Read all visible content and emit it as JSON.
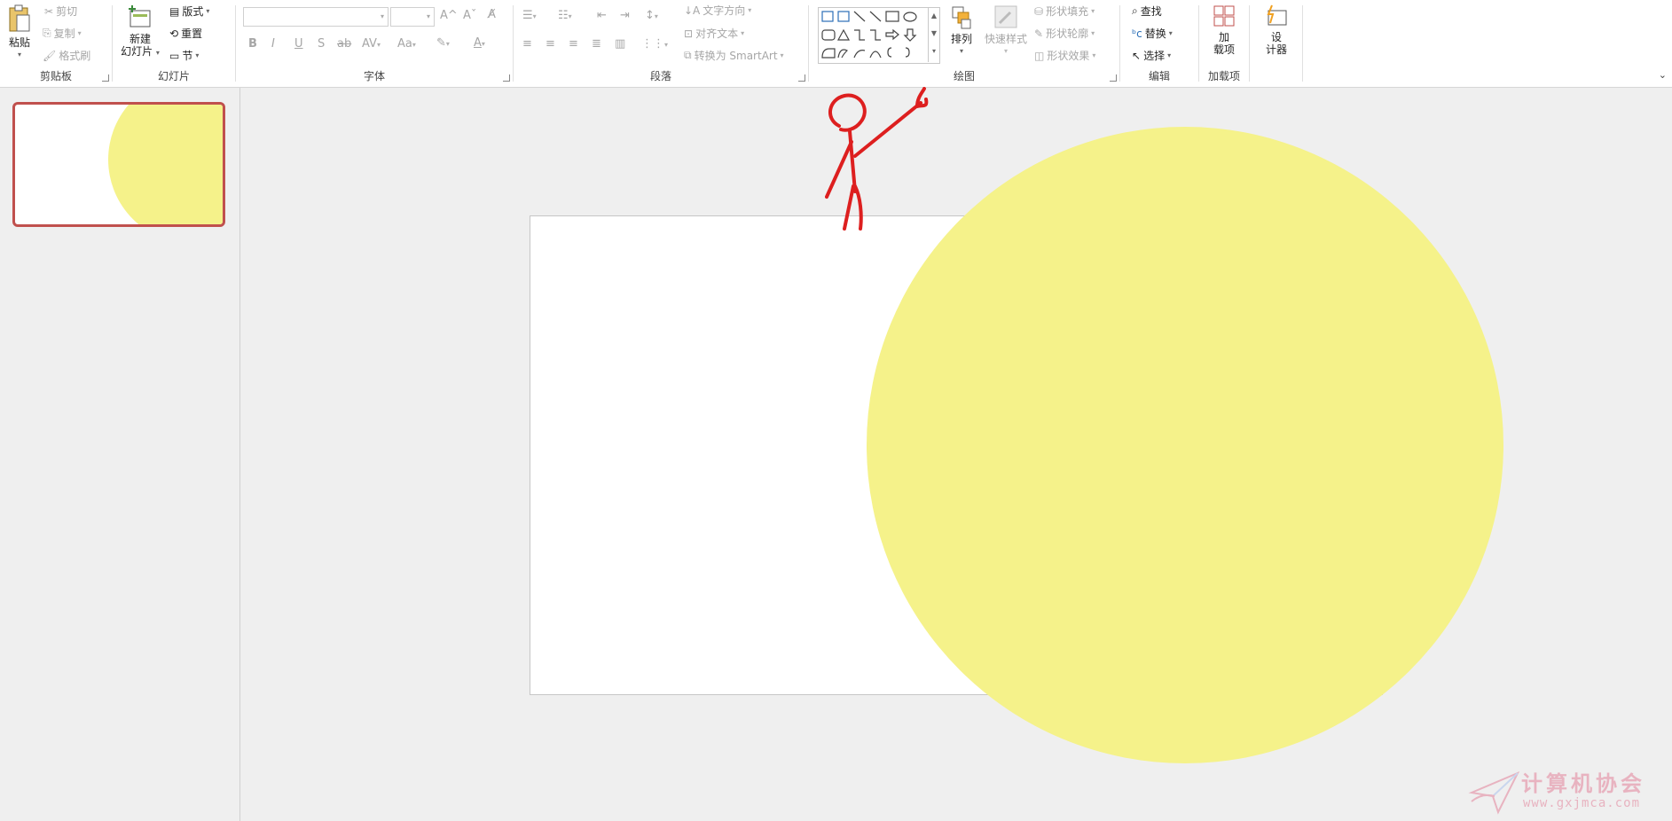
{
  "ribbon": {
    "clipboard": {
      "paste": "粘贴",
      "cut": "剪切",
      "copy": "复制",
      "format_painter": "格式刷",
      "label": "剪贴板"
    },
    "slides": {
      "new_slide_line1": "新建",
      "new_slide_line2": "幻灯片",
      "layout": "版式",
      "reset": "重置",
      "section": "节",
      "label": "幻灯片"
    },
    "font": {
      "label": "字体",
      "bold": "B",
      "italic": "I",
      "underline": "U",
      "shadow": "S",
      "strike": "ab",
      "spacing": "AV",
      "case": "Aa",
      "grow": "A^",
      "shrink": "Aˇ",
      "color": "A"
    },
    "paragraph": {
      "label": "段落",
      "text_direction": "文字方向",
      "align_text": "对齐文本",
      "smartart": "转换为 SmartArt"
    },
    "drawing": {
      "label": "绘图",
      "arrange": "排列",
      "quick_styles": "快速样式",
      "shape_fill": "形状填充",
      "shape_outline": "形状轮廓",
      "shape_effects": "形状效果"
    },
    "editing": {
      "label": "编辑",
      "find": "查找",
      "replace": "替换",
      "select": "选择"
    },
    "addins": {
      "label": "加载项",
      "addins_line1": "加",
      "addins_line2": "载项"
    },
    "designer": {
      "line1": "设",
      "line2": "计器"
    }
  },
  "colors": {
    "circle_fill": "#f5f28a",
    "stick_figure": "#dd1f1f",
    "thumb_border": "#c0504d"
  },
  "watermark": {
    "title": "计算机协会",
    "url": "www.gxjmca.com"
  }
}
